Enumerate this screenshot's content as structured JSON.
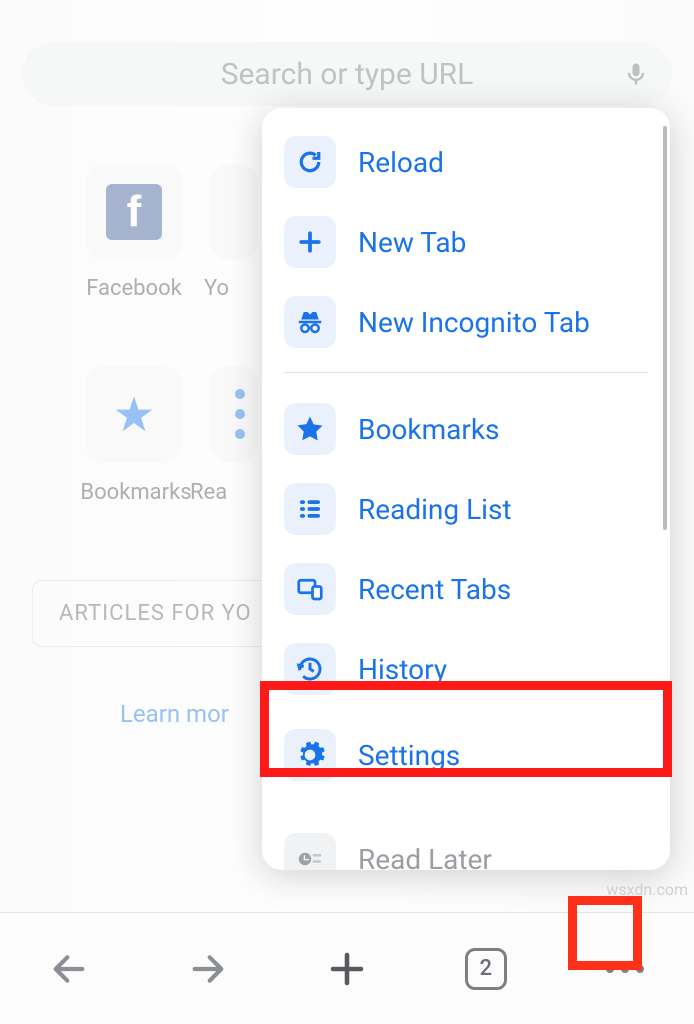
{
  "search": {
    "placeholder": "Search or type URL"
  },
  "shortcuts": {
    "facebook": "Facebook",
    "youtube_partial": "Yo",
    "bookmarks": "Bookmarks",
    "readinglist_partial": "Rea"
  },
  "articles": {
    "label": "ARTICLES FOR YO"
  },
  "learn_more": "Learn mor",
  "menu": {
    "reload": "Reload",
    "newtab": "New Tab",
    "incognito": "New Incognito Tab",
    "bookmarks": "Bookmarks",
    "readinglist": "Reading List",
    "recenttabs": "Recent Tabs",
    "history": "History",
    "settings": "Settings",
    "readlater": "Read Later"
  },
  "toolbar": {
    "tab_count": "2"
  },
  "watermark": "wsxdn.com",
  "icon_names": {
    "mic": "microphone-icon",
    "reload": "reload-icon",
    "plus": "plus-icon",
    "incognito": "incognito-icon",
    "star": "star-icon",
    "readinglist": "list-icon",
    "recenttabs": "devices-icon",
    "history": "history-icon",
    "settings": "gear-icon",
    "readlater": "read-later-icon",
    "back": "arrow-back-icon",
    "forward": "arrow-forward-icon",
    "newtab_toolbar": "plus-icon",
    "tabs": "tabs-icon",
    "more": "more-icon"
  },
  "colors": {
    "accent": "#1a73e8",
    "highlight": "#ff1a1a",
    "text_muted": "#77797b",
    "facebook": "#3b5998"
  }
}
